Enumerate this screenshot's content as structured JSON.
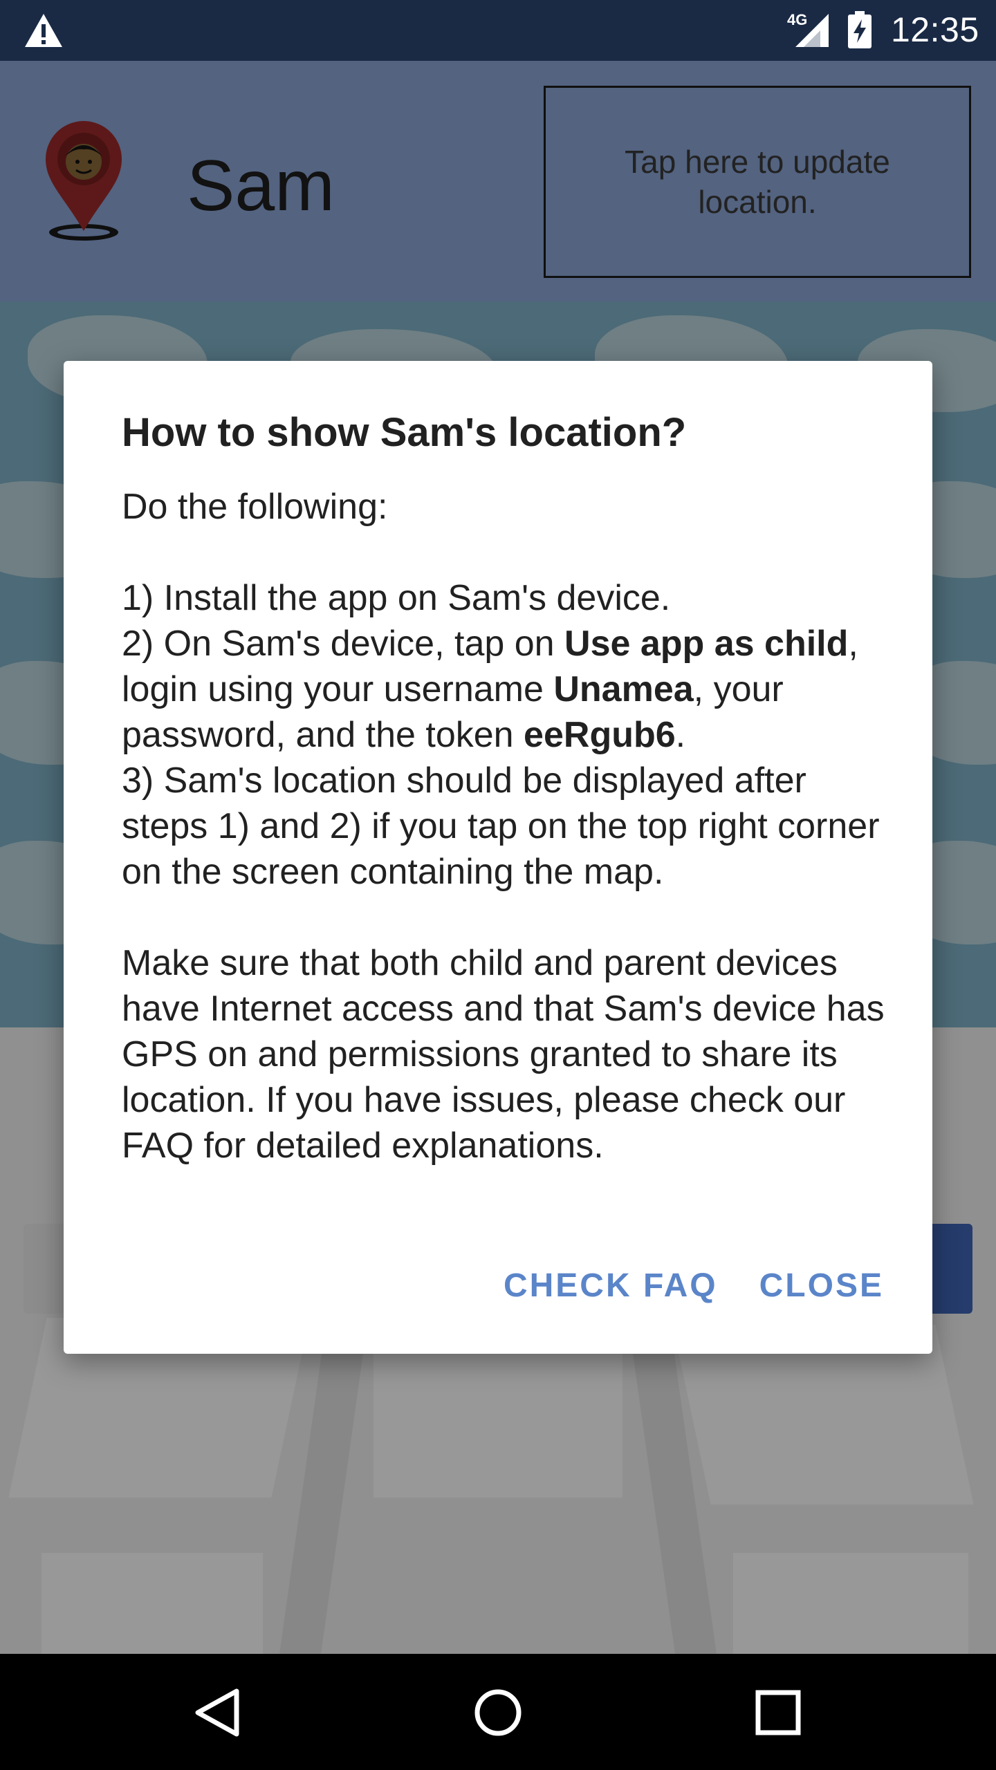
{
  "status_bar": {
    "time": "12:35",
    "network": "4G",
    "icons": [
      "warning-icon",
      "signal-icon",
      "battery-charging-icon"
    ]
  },
  "header": {
    "child_name": "Sam",
    "update_location": "Tap here to update location.",
    "avatar_icon": "child-location-pin-icon"
  },
  "dialog": {
    "title": "How to show Sam's location?",
    "intro": "Do the following:",
    "step1": "1) Install the app on Sam's device.",
    "step2": {
      "prefix": "2) On Sam's device, tap on ",
      "action": "Use app as child",
      "mid1": ", login using your username ",
      "username": "Unamea",
      "mid2": ", your password, and the token ",
      "token": "eeRgub6",
      "suffix": "."
    },
    "step3": "3) Sam's location should be displayed after steps 1) and 2) if you tap on the top right corner on the screen containing the map.",
    "note": "Make sure that both child and parent devices have Internet access and that Sam's device has GPS on and permissions granted to share its location. If you have issues, please check our FAQ for detailed explanations.",
    "actions": {
      "check_faq": "CHECK FAQ",
      "close": "CLOSE"
    }
  },
  "colors": {
    "status_bar": "#1a2a45",
    "header": "#8ba5d6",
    "action_text": "#5b85c9",
    "map_water": "#7fb1c6"
  },
  "nav_bar": {
    "icons": [
      "back-icon",
      "home-icon",
      "recents-icon"
    ]
  }
}
